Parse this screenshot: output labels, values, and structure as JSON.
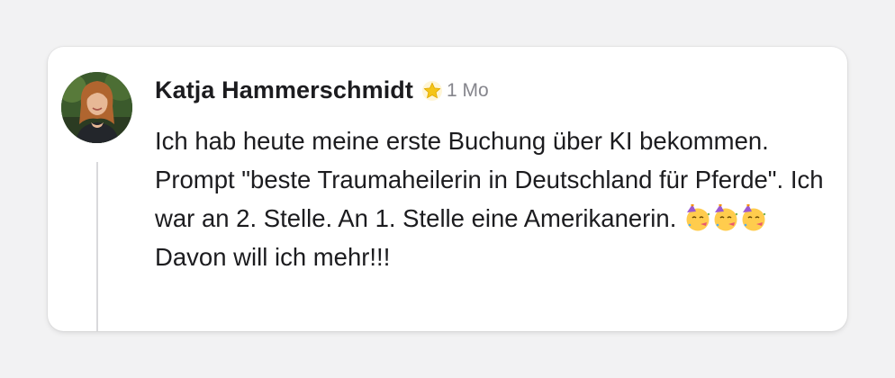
{
  "comment": {
    "author": "Katja Hammerschmidt",
    "badge_icon": "star-icon",
    "time": "1 Mo",
    "text_before_emoji": "Ich hab heute meine erste Buchung über KI bekommen. Prompt \"beste Traumaheilerin in Deutschland für Pferde\". Ich war an 2. Stelle. An 1. Stelle eine Amerikanerin.",
    "emojis": [
      "partying-face",
      "partying-face",
      "partying-face"
    ],
    "text_after_emoji": "Davon will ich mehr!!!"
  },
  "colors": {
    "background": "#f2f2f3",
    "card": "#ffffff",
    "text": "#1c1c1f",
    "muted": "#85858c",
    "thread_line": "#d9d9dc",
    "star": "#f5c518"
  }
}
